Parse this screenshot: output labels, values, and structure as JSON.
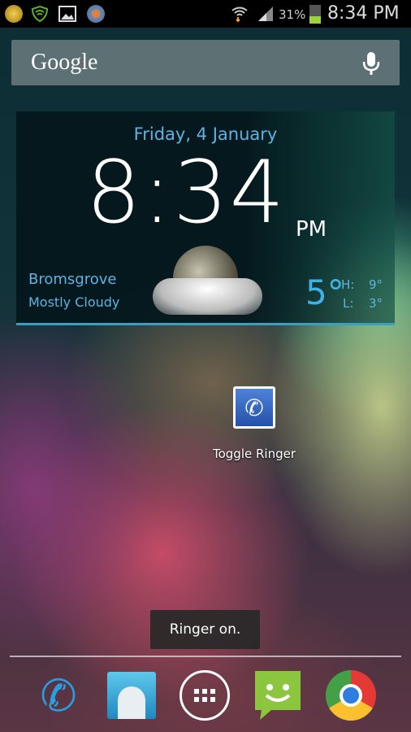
{
  "status_bar": {
    "battery": "31%",
    "time": "8:34 PM",
    "battery_level": 0.31,
    "icons": [
      "sun-icon",
      "shield-wifi-icon",
      "image-icon",
      "tasker-gear-icon",
      "wifi-icon",
      "signal-icon",
      "battery-icon"
    ]
  },
  "search": {
    "logo": "Google",
    "mic": "mic-icon"
  },
  "clock": {
    "date": "Friday, 4 January",
    "time": "8:34",
    "ampm": "PM"
  },
  "weather": {
    "city": "Bromsgrove",
    "condition": "Mostly Cloudy",
    "temp": "5°",
    "high_label": "H:",
    "high": "9°",
    "low_label": "L:",
    "low": "3°"
  },
  "app": {
    "label": "Toggle Ringer"
  },
  "toast": "Ringer on.",
  "dock": [
    "Phone",
    "Contacts",
    "Apps",
    "Messaging",
    "Chrome"
  ],
  "colors": {
    "accent": "#5fb3e0",
    "battery": "#9bd33a"
  }
}
